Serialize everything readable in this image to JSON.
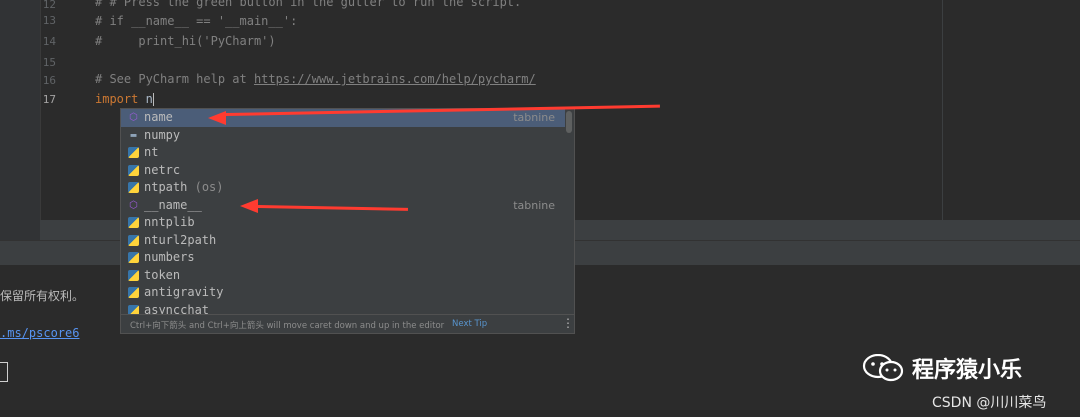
{
  "editor": {
    "lines": [
      {
        "num": "12",
        "text": "# # Press the green button in the gutter to run the script."
      },
      {
        "num": "13",
        "text": "# if __name__ == '__main__':"
      },
      {
        "num": "14",
        "text": "#     print_hi('PyCharm')"
      },
      {
        "num": "15",
        "text": ""
      },
      {
        "num": "16",
        "text_prefix": "# See PyCharm help at ",
        "link": "https://www.jetbrains.com/help/pycharm/"
      },
      {
        "num": "17",
        "keyword": "import",
        "typed": "n"
      }
    ]
  },
  "completion": {
    "items": [
      {
        "label": "name",
        "icon": "hexagon-icon",
        "source": "tabnine",
        "selected": true
      },
      {
        "label": "numpy",
        "icon": "folder-icon"
      },
      {
        "label": "nt",
        "icon": "python-module-icon"
      },
      {
        "label": "netrc",
        "icon": "python-module-icon"
      },
      {
        "label": "ntpath",
        "hint": "(os)",
        "icon": "python-module-icon"
      },
      {
        "label": "__name__",
        "icon": "hexagon-icon",
        "source": "tabnine"
      },
      {
        "label": "nntplib",
        "icon": "python-module-icon"
      },
      {
        "label": "nturl2path",
        "icon": "python-module-icon"
      },
      {
        "label": "numbers",
        "icon": "python-module-icon"
      },
      {
        "label": "token",
        "icon": "python-module-icon"
      },
      {
        "label": "antigravity",
        "icon": "python-module-icon"
      },
      {
        "label": "asyncchat",
        "icon": "python-module-icon"
      }
    ],
    "footer_tip": "Ctrl+向下箭头 and Ctrl+向上箭头 will move caret down and up in the editor",
    "next_tip": "Next Tip"
  },
  "console": {
    "line1": "保留所有权利。",
    "link": ".ms/pscore6"
  },
  "watermark": {
    "brand": "程序猿小乐",
    "csdn": "CSDN @川川菜鸟"
  },
  "colors": {
    "annotation_arrow": "#ff3b30",
    "selection": "#4b5d78"
  }
}
